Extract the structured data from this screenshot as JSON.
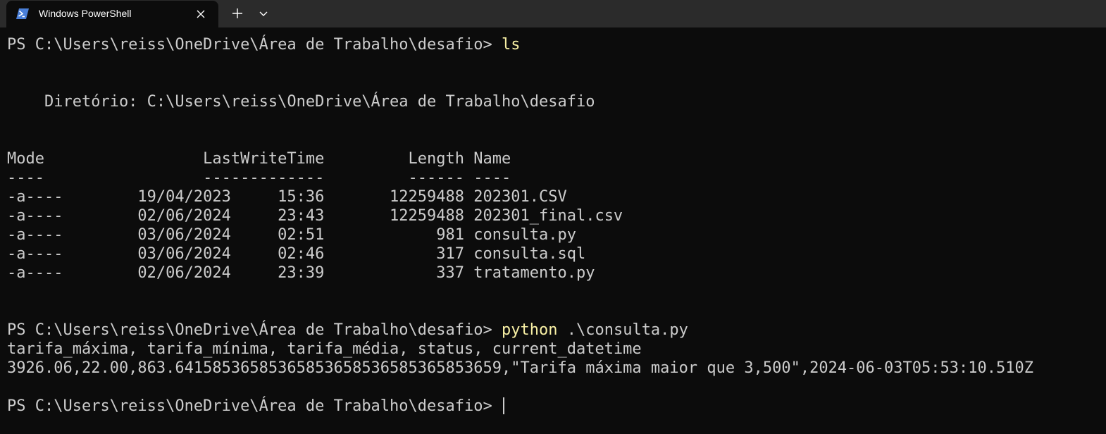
{
  "window": {
    "tab_title": "Windows PowerShell",
    "tab_icon": "powershell-icon",
    "close_icon": "close-icon",
    "new_tab_icon": "plus-icon",
    "dropdown_icon": "chevron-down-icon"
  },
  "colors": {
    "background": "#0c0c0c",
    "titlebar": "#2b2b2b",
    "text": "#cccccc",
    "command": "#f9f1a5",
    "ps_icon": "#4a7fd8"
  },
  "terminal": {
    "prompt": "PS C:\\Users\\reiss\\OneDrive\\Área de Trabalho\\desafio> ",
    "command1": "ls",
    "directory_line": "    Diretório: C:\\Users\\reiss\\OneDrive\\Área de Trabalho\\desafio",
    "listing": [
      "Mode                 LastWriteTime         Length Name",
      "----                 -------------         ------ ----",
      "-a----        19/04/2023     15:36       12259488 202301.CSV",
      "-a----        02/06/2024     23:43       12259488 202301_final.csv",
      "-a----        03/06/2024     02:51            981 consulta.py",
      "-a----        03/06/2024     02:46            317 consulta.sql",
      "-a----        02/06/2024     23:39            337 tratamento.py"
    ],
    "command2_name": "python",
    "command2_args": " .\\consulta.py",
    "output": [
      "tarifa_máxima, tarifa_mínima, tarifa_média, status, current_datetime",
      "3926.06,22.00,863.64158536585365853658536585365853659,\"Tarifa máxima maior que 3,500\",2024-06-03T05:53:10.510Z"
    ]
  }
}
